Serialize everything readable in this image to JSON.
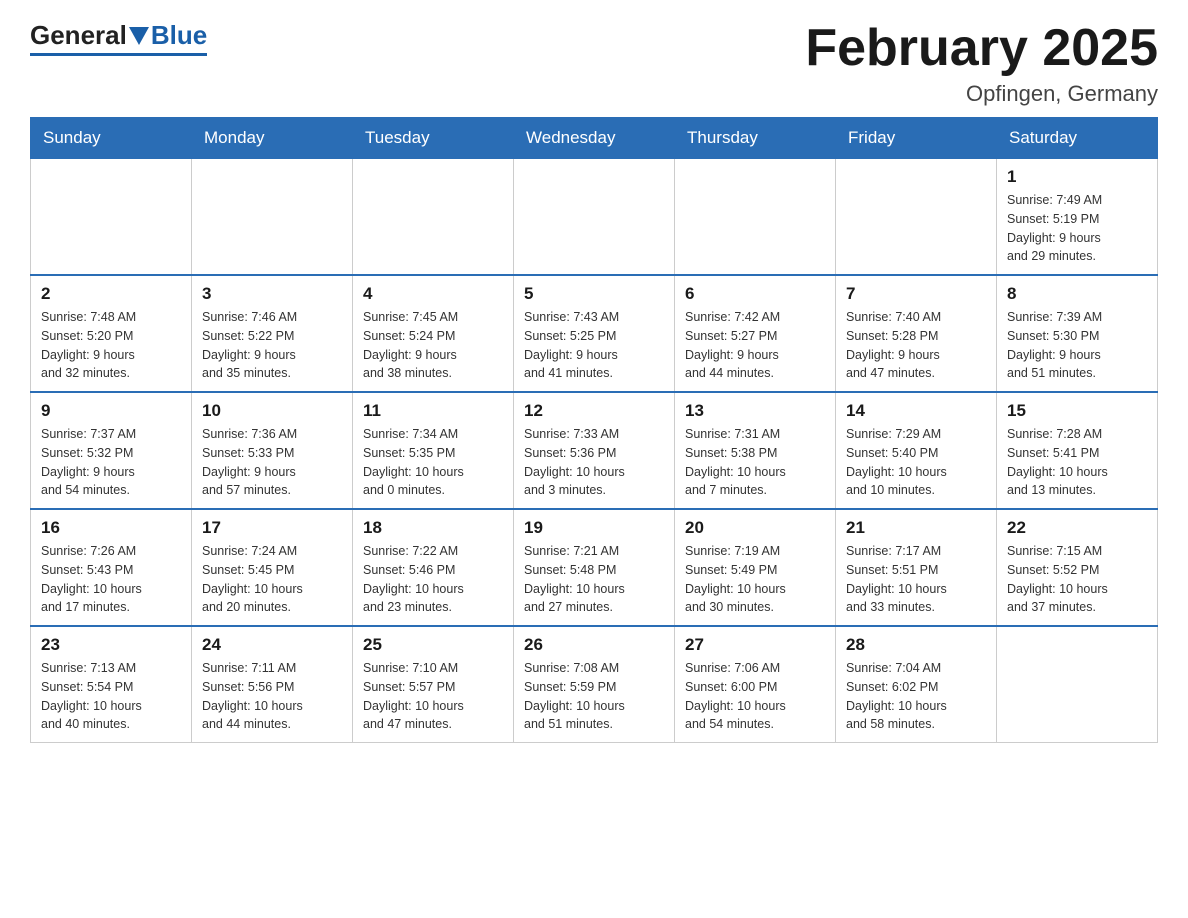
{
  "logo": {
    "general": "General",
    "blue": "Blue"
  },
  "header": {
    "title": "February 2025",
    "location": "Opfingen, Germany"
  },
  "weekdays": [
    "Sunday",
    "Monday",
    "Tuesday",
    "Wednesday",
    "Thursday",
    "Friday",
    "Saturday"
  ],
  "weeks": [
    [
      {
        "day": "",
        "info": "",
        "empty": true
      },
      {
        "day": "",
        "info": "",
        "empty": true
      },
      {
        "day": "",
        "info": "",
        "empty": true
      },
      {
        "day": "",
        "info": "",
        "empty": true
      },
      {
        "day": "",
        "info": "",
        "empty": true
      },
      {
        "day": "",
        "info": "",
        "empty": true
      },
      {
        "day": "1",
        "info": "Sunrise: 7:49 AM\nSunset: 5:19 PM\nDaylight: 9 hours\nand 29 minutes."
      }
    ],
    [
      {
        "day": "2",
        "info": "Sunrise: 7:48 AM\nSunset: 5:20 PM\nDaylight: 9 hours\nand 32 minutes."
      },
      {
        "day": "3",
        "info": "Sunrise: 7:46 AM\nSunset: 5:22 PM\nDaylight: 9 hours\nand 35 minutes."
      },
      {
        "day": "4",
        "info": "Sunrise: 7:45 AM\nSunset: 5:24 PM\nDaylight: 9 hours\nand 38 minutes."
      },
      {
        "day": "5",
        "info": "Sunrise: 7:43 AM\nSunset: 5:25 PM\nDaylight: 9 hours\nand 41 minutes."
      },
      {
        "day": "6",
        "info": "Sunrise: 7:42 AM\nSunset: 5:27 PM\nDaylight: 9 hours\nand 44 minutes."
      },
      {
        "day": "7",
        "info": "Sunrise: 7:40 AM\nSunset: 5:28 PM\nDaylight: 9 hours\nand 47 minutes."
      },
      {
        "day": "8",
        "info": "Sunrise: 7:39 AM\nSunset: 5:30 PM\nDaylight: 9 hours\nand 51 minutes."
      }
    ],
    [
      {
        "day": "9",
        "info": "Sunrise: 7:37 AM\nSunset: 5:32 PM\nDaylight: 9 hours\nand 54 minutes."
      },
      {
        "day": "10",
        "info": "Sunrise: 7:36 AM\nSunset: 5:33 PM\nDaylight: 9 hours\nand 57 minutes."
      },
      {
        "day": "11",
        "info": "Sunrise: 7:34 AM\nSunset: 5:35 PM\nDaylight: 10 hours\nand 0 minutes."
      },
      {
        "day": "12",
        "info": "Sunrise: 7:33 AM\nSunset: 5:36 PM\nDaylight: 10 hours\nand 3 minutes."
      },
      {
        "day": "13",
        "info": "Sunrise: 7:31 AM\nSunset: 5:38 PM\nDaylight: 10 hours\nand 7 minutes."
      },
      {
        "day": "14",
        "info": "Sunrise: 7:29 AM\nSunset: 5:40 PM\nDaylight: 10 hours\nand 10 minutes."
      },
      {
        "day": "15",
        "info": "Sunrise: 7:28 AM\nSunset: 5:41 PM\nDaylight: 10 hours\nand 13 minutes."
      }
    ],
    [
      {
        "day": "16",
        "info": "Sunrise: 7:26 AM\nSunset: 5:43 PM\nDaylight: 10 hours\nand 17 minutes."
      },
      {
        "day": "17",
        "info": "Sunrise: 7:24 AM\nSunset: 5:45 PM\nDaylight: 10 hours\nand 20 minutes."
      },
      {
        "day": "18",
        "info": "Sunrise: 7:22 AM\nSunset: 5:46 PM\nDaylight: 10 hours\nand 23 minutes."
      },
      {
        "day": "19",
        "info": "Sunrise: 7:21 AM\nSunset: 5:48 PM\nDaylight: 10 hours\nand 27 minutes."
      },
      {
        "day": "20",
        "info": "Sunrise: 7:19 AM\nSunset: 5:49 PM\nDaylight: 10 hours\nand 30 minutes."
      },
      {
        "day": "21",
        "info": "Sunrise: 7:17 AM\nSunset: 5:51 PM\nDaylight: 10 hours\nand 33 minutes."
      },
      {
        "day": "22",
        "info": "Sunrise: 7:15 AM\nSunset: 5:52 PM\nDaylight: 10 hours\nand 37 minutes."
      }
    ],
    [
      {
        "day": "23",
        "info": "Sunrise: 7:13 AM\nSunset: 5:54 PM\nDaylight: 10 hours\nand 40 minutes."
      },
      {
        "day": "24",
        "info": "Sunrise: 7:11 AM\nSunset: 5:56 PM\nDaylight: 10 hours\nand 44 minutes."
      },
      {
        "day": "25",
        "info": "Sunrise: 7:10 AM\nSunset: 5:57 PM\nDaylight: 10 hours\nand 47 minutes."
      },
      {
        "day": "26",
        "info": "Sunrise: 7:08 AM\nSunset: 5:59 PM\nDaylight: 10 hours\nand 51 minutes."
      },
      {
        "day": "27",
        "info": "Sunrise: 7:06 AM\nSunset: 6:00 PM\nDaylight: 10 hours\nand 54 minutes."
      },
      {
        "day": "28",
        "info": "Sunrise: 7:04 AM\nSunset: 6:02 PM\nDaylight: 10 hours\nand 58 minutes."
      },
      {
        "day": "",
        "info": "",
        "empty": true
      }
    ]
  ]
}
